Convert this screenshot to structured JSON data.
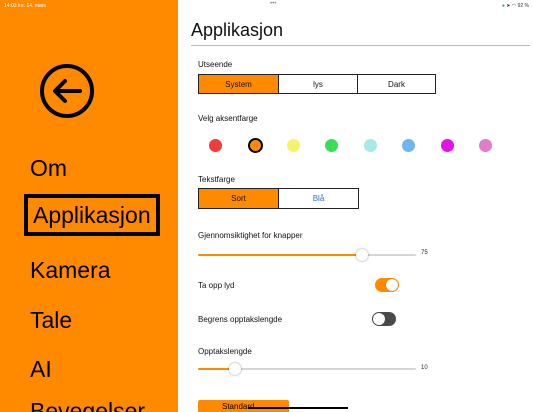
{
  "status_bar": {
    "time": "14:03  fre. 14. mars",
    "dots": "•••",
    "battery": "92 %"
  },
  "sidebar": {
    "items": [
      {
        "label": "Om",
        "active": false
      },
      {
        "label": "Applikasjon",
        "active": true
      },
      {
        "label": "Kamera",
        "active": false
      },
      {
        "label": "Tale",
        "active": false
      },
      {
        "label": "AI",
        "active": false
      },
      {
        "label": "Bevegelser",
        "active": false
      }
    ]
  },
  "page": {
    "title": "Applikasjon"
  },
  "appearance": {
    "label": "Utseende",
    "options": [
      "System",
      "lys",
      "Dark"
    ],
    "selected": "System"
  },
  "accent": {
    "label": "Velg aksentfarge",
    "colors": [
      "#f03c3c",
      "#ff8a00",
      "#f4f46a",
      "#3bdc58",
      "#a7e9e9",
      "#6fb5ef",
      "#e314e3",
      "#e07cc8"
    ],
    "selected": "#ff8a00"
  },
  "text_color": {
    "label": "Tekstfarge",
    "options": [
      "Sort",
      "Blå"
    ],
    "selected": "Sort",
    "option_colors": [
      "#111111",
      "#2f6fd6"
    ]
  },
  "opacity": {
    "label": "Gjennomsiktighet for knapper",
    "value": "75",
    "fraction": 0.75
  },
  "record_sound": {
    "label": "Ta opp lyd",
    "on": true
  },
  "limit_length": {
    "label": "Begrens opptakslengde",
    "on": false
  },
  "record_length": {
    "label": "Opptakslengde",
    "value": "10",
    "fraction": 0.17
  },
  "bottom_button": {
    "label": "Standard"
  },
  "colors": {
    "accent": "#ff8a00",
    "toggle_off": "#4a4a4a"
  }
}
